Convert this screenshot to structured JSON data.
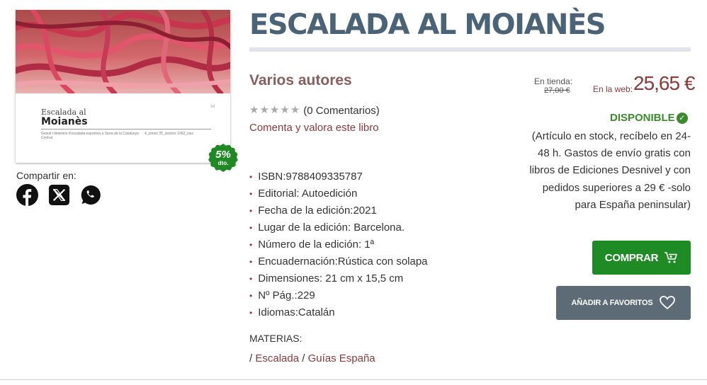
{
  "book": {
    "title": "ESCALADA AL MOIANÈS",
    "author": "Varios autores",
    "rating_stars": 0,
    "comments": "(0 Comentarios)",
    "rate_link": "Comenta y valora este libro"
  },
  "cover": {
    "small_title": "Escalada al",
    "big_title": "Moianès",
    "subtitle": "Gesutl i itineraris d'escalada esportiva a l'àrea de la Catalunya Central",
    "stats": "4_zones    35_sectors    1062_vies",
    "side": "S4"
  },
  "discount": {
    "percent": "5%",
    "label": "dto."
  },
  "share": {
    "label": "Compartir en:",
    "icons": [
      "facebook-icon",
      "x-icon",
      "whatsapp-icon"
    ]
  },
  "details": [
    "ISBN:9788409335787",
    "Editorial: Autoedición",
    "Fecha de la edición:2021",
    "Lugar de la edición: Barcelona.",
    "Número de la edición: 1ª",
    "Encuadernación:Rústica con solapa",
    "Dimensiones: 21 cm x 15,5 cm",
    "Nº Pág.:229",
    "Idiomas:Catalán"
  ],
  "materias": {
    "label": "MATERIAS:",
    "sep": "/",
    "items": [
      "Escalada",
      "Guías España"
    ]
  },
  "price": {
    "store_label": "En tienda:",
    "store_price": "27,00 €",
    "web_label": "En la web:",
    "web_price": "25,65 €"
  },
  "availability": {
    "status": "DISPONIBLE",
    "note": "(Artículo en stock, recíbelo en 24-48 h. Gastos de envío gratis con libros de Ediciones Desnivel y con pedidos superiores a 29 € -solo para España peninsular)"
  },
  "actions": {
    "buy_label": "COMPRAR",
    "fav_label": "AÑADIR A FAVORITOS"
  },
  "colors": {
    "title": "#4b6377",
    "accent": "#8b3a3a",
    "buy": "#1f8b24",
    "fav": "#5d6b77",
    "available": "#3c8c2e"
  }
}
